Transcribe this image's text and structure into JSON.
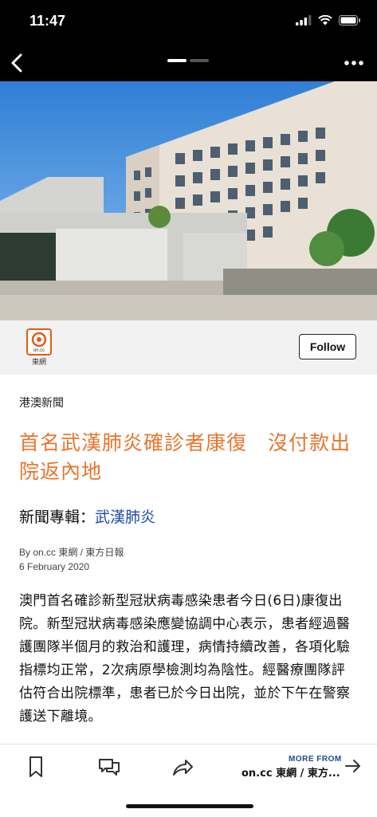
{
  "status": {
    "time": "11:47"
  },
  "nav": {
    "back_icon": "chevron-left-icon",
    "more_icon": "ellipsis-icon"
  },
  "publisher": {
    "logo_text": "on.cc",
    "logo_caption": "東網",
    "follow_label": "Follow"
  },
  "article": {
    "category": "港澳新聞",
    "headline": "首名武漢肺炎確診者康復　沒付款出院返內地",
    "topic_prefix": "新聞專輯：",
    "topic_link": "武漢肺炎",
    "byline": "By on.cc 東網 / 東方日報",
    "date": "6 February 2020",
    "body": "澳門首名確診新型冠狀病毒感染患者今日(6日)康復出院。新型冠狀病毒感染應變協調中心表示，患者經過醫護團隊半個月的救治和護理，病情持續改善，各項化驗指標均正常，2次病原學檢測均為陰性。經醫療團隊評估符合出院標準，患者已於今日出院，並於下午在警察護送下離境。"
  },
  "toolbar": {
    "bookmark_icon": "bookmark-icon",
    "comment_icon": "comment-icon",
    "share_icon": "share-icon",
    "more_from_label": "MORE FROM",
    "more_from_source": "on.cc 東網 / 東方..."
  },
  "colors": {
    "headline": "#e8762c",
    "topic_link": "#1f4aa8",
    "more_from_label": "#1c4a8a"
  }
}
